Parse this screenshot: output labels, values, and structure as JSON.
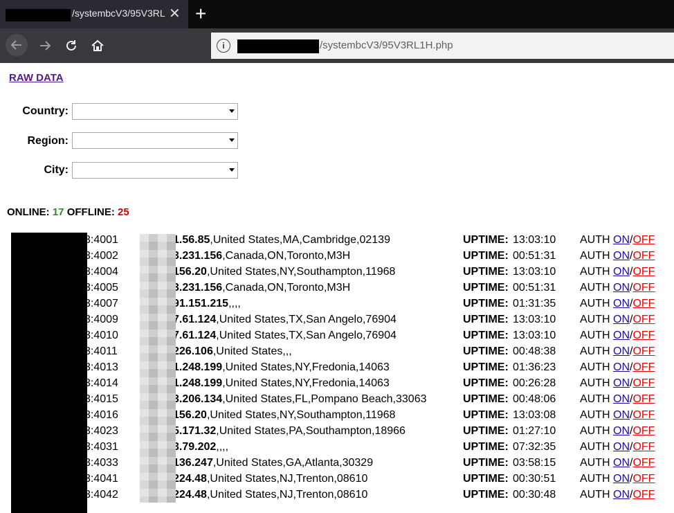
{
  "browser": {
    "tab_title": "/systembcV3/95V3RL",
    "tab_close": "✕",
    "new_tab": "+",
    "url": "/systembcV3/95V3RL1H.php",
    "info": "i"
  },
  "page": {
    "raw_link": "RAW DATA",
    "filters": {
      "country_label": "Country:",
      "region_label": "Region:",
      "city_label": "City:"
    },
    "status": {
      "online_label": "ONLINE:",
      "online_count": "17",
      "offline_label": "OFFLINE:",
      "offline_count": "25"
    },
    "colors": {
      "online": "#2e8b22",
      "offline": "#cc0000",
      "link": "#551a8b",
      "on_link": "#1a0dab",
      "off_link": "#ee0000"
    },
    "rows": [
      {
        "port": "3:4001",
        "ip": "1.56.85",
        "loc": ",United States,MA,Cambridge,02139",
        "uptime": "13:03:10"
      },
      {
        "port": "3:4002",
        "ip": "3.231.156",
        "loc": ",Canada,ON,Toronto,M3H",
        "uptime": "00:51:31"
      },
      {
        "port": "3:4004",
        "ip": "156.20",
        "loc": ",United States,NY,Southampton,11968",
        "uptime": "13:03:10"
      },
      {
        "port": "3:4005",
        "ip": "3.231.156",
        "loc": ",Canada,ON,Toronto,M3H",
        "uptime": "00:51:31"
      },
      {
        "port": "3:4007",
        "ip": "91.151.215",
        "loc": ",,,,",
        "uptime": "01:31:35"
      },
      {
        "port": "3:4009",
        "ip": "7.61.124",
        "loc": ",United States,TX,San Angelo,76904",
        "uptime": "13:03:10"
      },
      {
        "port": "3:4010",
        "ip": "7.61.124",
        "loc": ",United States,TX,San Angelo,76904",
        "uptime": "13:03:10"
      },
      {
        "port": "3:4011",
        "ip": "226.106",
        "loc": ",United States,,,",
        "uptime": "00:48:38"
      },
      {
        "port": "3:4013",
        "ip": "1.248.199",
        "loc": ",United States,NY,Fredonia,14063",
        "uptime": "01:36:23"
      },
      {
        "port": "3:4014",
        "ip": "1.248.199",
        "loc": ",United States,NY,Fredonia,14063",
        "uptime": "00:26:28"
      },
      {
        "port": "3:4015",
        "ip": "3.206.134",
        "loc": ",United States,FL,Pompano Beach,33063",
        "uptime": "00:48:06"
      },
      {
        "port": "3:4016",
        "ip": "156.20",
        "loc": ",United States,NY,Southampton,11968",
        "uptime": "13:03:08"
      },
      {
        "port": "3:4023",
        "ip": "5.171.32",
        "loc": ",United States,PA,Southampton,18966",
        "uptime": "01:27:10"
      },
      {
        "port": "3:4031",
        "ip": "3.79.202",
        "loc": ",,,,",
        "uptime": "07:32:35"
      },
      {
        "port": "3:4033",
        "ip": "136.247",
        "loc": ",United States,GA,Atlanta,30329",
        "uptime": "03:58:15"
      },
      {
        "port": "3:4041",
        "ip": "224.48",
        "loc": ",United States,NJ,Trenton,08610",
        "uptime": "00:30:51"
      },
      {
        "port": "3:4042",
        "ip": "224.48",
        "loc": ",United States,NJ,Trenton,08610",
        "uptime": "00:30:48"
      }
    ],
    "labels": {
      "uptime": "UPTIME:",
      "auth": "AUTH ",
      "on": "ON",
      "sep": "/",
      "off": "OFF"
    }
  }
}
